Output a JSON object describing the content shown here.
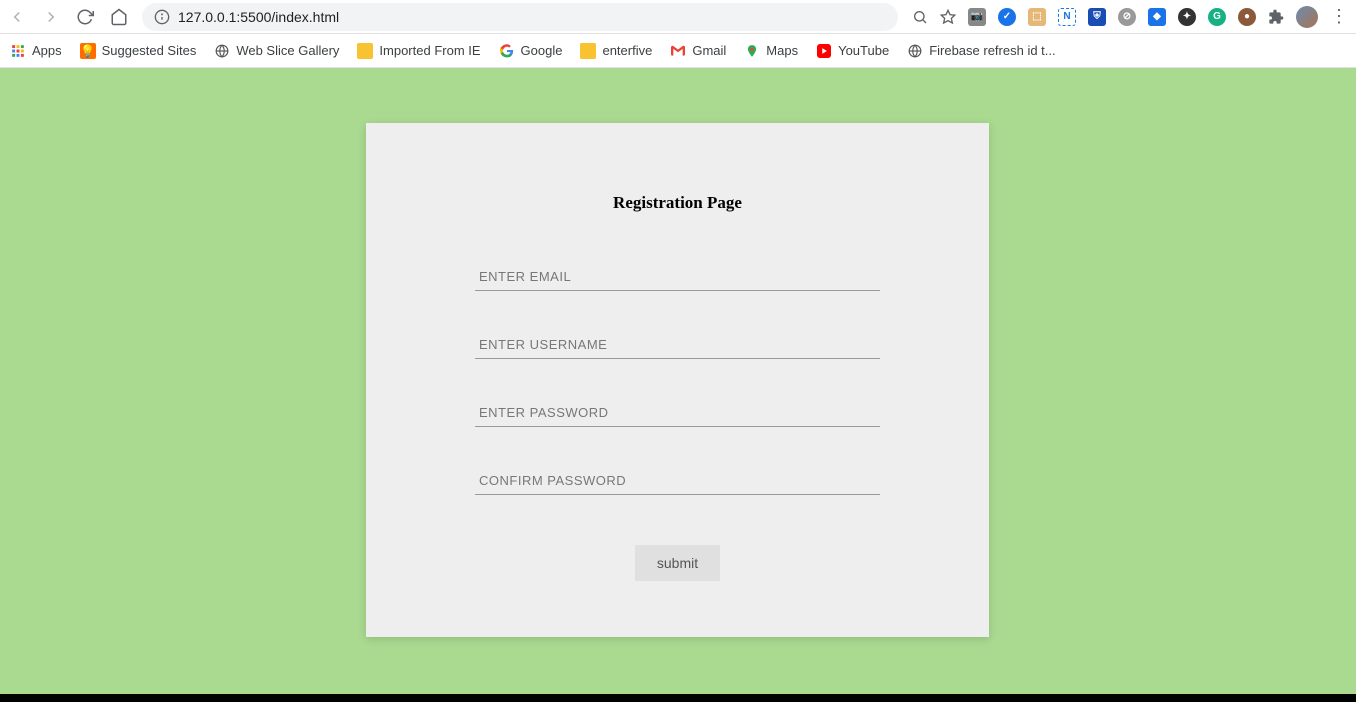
{
  "browser": {
    "url": "127.0.0.1:5500/index.html"
  },
  "bookmarks": {
    "apps": "Apps",
    "suggested": "Suggested Sites",
    "webslice": "Web Slice Gallery",
    "imported": "Imported From IE",
    "google": "Google",
    "enterfive": "enterfive",
    "gmail": "Gmail",
    "maps": "Maps",
    "youtube": "YouTube",
    "firebase": "Firebase refresh id t..."
  },
  "page": {
    "heading": "Registration Page",
    "placeholders": {
      "email": "ENTER EMAIL",
      "username": "ENTER USERNAME",
      "password": "ENTER PASSWORD",
      "confirm": "CONFIRM PASSWORD"
    },
    "submit_label": "submit"
  }
}
